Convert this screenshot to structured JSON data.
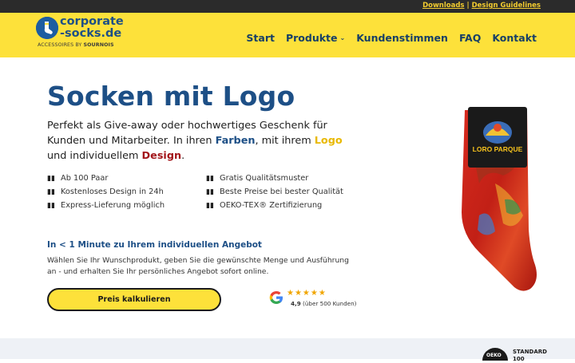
{
  "topbar": {
    "downloads": "Downloads",
    "separator": "|",
    "guidelines": "Design Guidelines"
  },
  "brand": {
    "name_line1": "corporate",
    "name_line2": "-socks.de",
    "sub_prefix": "ACCESSOIRES BY ",
    "sub_brand": "SOURNOIS"
  },
  "nav": {
    "items": [
      "Start",
      "Produkte",
      "Kundenstimmen",
      "FAQ",
      "Kontakt"
    ]
  },
  "hero": {
    "title": "Socken mit Logo",
    "text_a": "Perfekt als Give-away oder hochwertiges Geschenk für Kunden und Mitarbeiter. In ihren ",
    "word_colors": "Farben",
    "text_b": ", mit ihrem ",
    "word_logo": "Logo",
    "text_c": " und individuellem ",
    "word_design": "Design",
    "text_d": "."
  },
  "features_left": [
    "Ab 100 Paar",
    "Kostenloses Design in 24h",
    "Express-Lieferung möglich"
  ],
  "features_right": [
    "Gratis Qualitätsmuster",
    "Beste Preise bei bester Qualität",
    "OEKO-TEX® Zertifizierung"
  ],
  "offer": {
    "title": "In < 1 Minute zu Ihrem individuellen Angebot",
    "text": "Wählen Sie Ihr Wunschprodukt, geben Sie die gewünschte Menge und Ausführung an - und erhalten Sie Ihr persönliches Angebot sofort online."
  },
  "cta": {
    "label": "Preis kalkulieren"
  },
  "rating": {
    "stars": "★★★★★",
    "score": "4,9",
    "count": "(über 500 Kunden)",
    "stars_value": 5
  },
  "product": {
    "sock_label": "LORO PARQUE"
  },
  "certification": {
    "badge": "OEKO",
    "line1": "STANDARD",
    "line2": "100"
  },
  "colors": {
    "accent_yellow": "#fde13a",
    "brand_blue": "#1d4f86",
    "topbar": "#2b2b2b",
    "highlight_red": "#a3151a"
  }
}
